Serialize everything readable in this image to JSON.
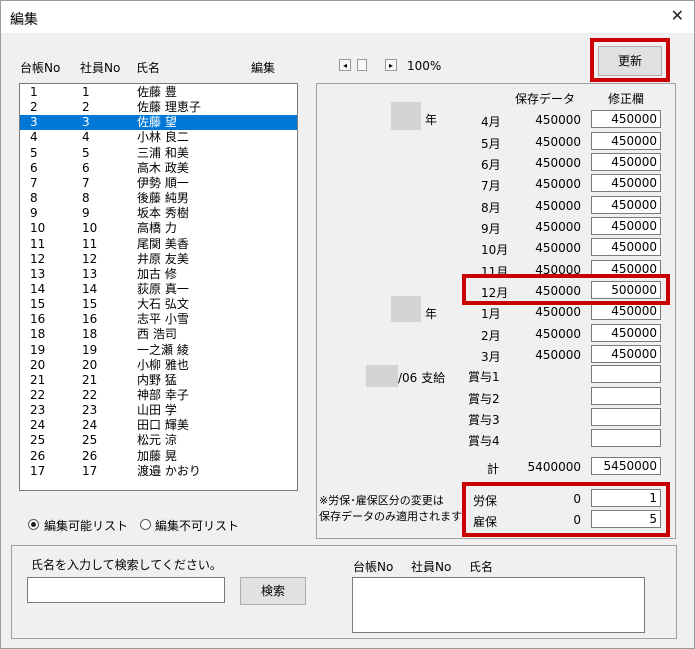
{
  "window": {
    "title": "編集",
    "close_glyph": "✕"
  },
  "list": {
    "headers": [
      "台帳No",
      "社員No",
      "氏名",
      "編集"
    ],
    "rows": [
      [
        "1",
        "1",
        "佐藤 豊"
      ],
      [
        "2",
        "2",
        "佐藤 理恵子"
      ],
      [
        "3",
        "3",
        "佐藤 望"
      ],
      [
        "4",
        "4",
        "小林 良二"
      ],
      [
        "5",
        "5",
        "三浦 和美"
      ],
      [
        "6",
        "6",
        "高木 政美"
      ],
      [
        "7",
        "7",
        "伊勢 順一"
      ],
      [
        "8",
        "8",
        "後藤 純男"
      ],
      [
        "9",
        "9",
        "坂本 秀樹"
      ],
      [
        "10",
        "10",
        "高橋 力"
      ],
      [
        "11",
        "11",
        "尾関 美香"
      ],
      [
        "12",
        "12",
        "井原 友美"
      ],
      [
        "13",
        "13",
        "加古 修"
      ],
      [
        "14",
        "14",
        "荻原 真一"
      ],
      [
        "15",
        "15",
        "大石 弘文"
      ],
      [
        "16",
        "16",
        "志平 小雪"
      ],
      [
        "18",
        "18",
        "西 浩司"
      ],
      [
        "19",
        "19",
        "一之瀬 綾"
      ],
      [
        "20",
        "20",
        "小柳 雅也"
      ],
      [
        "21",
        "21",
        "内野 猛"
      ],
      [
        "22",
        "22",
        "神部 幸子"
      ],
      [
        "23",
        "23",
        "山田 学"
      ],
      [
        "24",
        "24",
        "田口 輝美"
      ],
      [
        "25",
        "25",
        "松元 涼"
      ],
      [
        "26",
        "26",
        "加藤 晃"
      ],
      [
        "17",
        "17",
        "渡邉 かおり"
      ]
    ],
    "selected_index": 2
  },
  "zoom": {
    "label": "100%",
    "left_glyph": "◂",
    "right_glyph": "▸"
  },
  "update_button": "更新",
  "table": {
    "col_saved": "保存データ",
    "col_fix": "修正欄",
    "year_label": "年",
    "months": [
      {
        "label": "4月",
        "saved": "450000",
        "fix": "450000"
      },
      {
        "label": "5月",
        "saved": "450000",
        "fix": "450000"
      },
      {
        "label": "6月",
        "saved": "450000",
        "fix": "450000"
      },
      {
        "label": "7月",
        "saved": "450000",
        "fix": "450000"
      },
      {
        "label": "8月",
        "saved": "450000",
        "fix": "450000"
      },
      {
        "label": "9月",
        "saved": "450000",
        "fix": "450000"
      },
      {
        "label": "10月",
        "saved": "450000",
        "fix": "450000"
      },
      {
        "label": "11月",
        "saved": "450000",
        "fix": "450000"
      },
      {
        "label": "12月",
        "saved": "450000",
        "fix": "500000"
      },
      {
        "label": "1月",
        "saved": "450000",
        "fix": "450000"
      },
      {
        "label": "2月",
        "saved": "450000",
        "fix": "450000"
      },
      {
        "label": "3月",
        "saved": "450000",
        "fix": "450000"
      }
    ],
    "bonus_payment": "/06 支給",
    "bonus": [
      "賞与1",
      "賞与2",
      "賞与3",
      "賞与4"
    ],
    "total_label": "計",
    "total_saved": "5400000",
    "total_fix": "5450000",
    "note_line1": "※労保･雇保区分の変更は",
    "note_line2": "保存データのみ適用されます",
    "insurance": [
      {
        "label": "労保",
        "saved": "0",
        "fix": "1"
      },
      {
        "label": "雇保",
        "saved": "0",
        "fix": "5"
      }
    ]
  },
  "radios": {
    "editable": "編集可能リスト",
    "non_editable": "編集不可リスト"
  },
  "search": {
    "instruction": "氏名を入力して検索してください。",
    "button": "検索",
    "result_headers": [
      "台帳No",
      "社員No",
      "氏名"
    ]
  }
}
